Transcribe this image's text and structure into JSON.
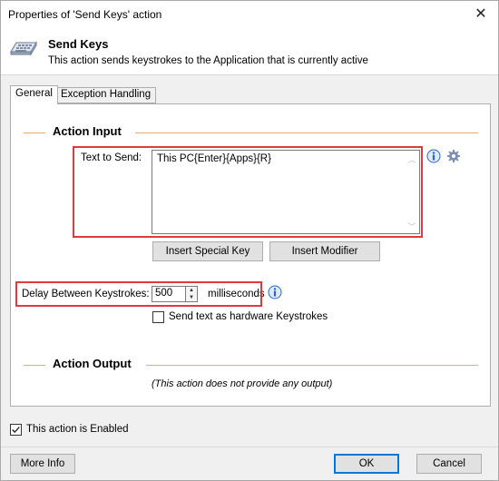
{
  "window": {
    "title": "Properties of 'Send Keys' action",
    "close_glyph": "✕"
  },
  "header": {
    "title": "Send Keys",
    "description": "This action sends keystrokes to the Application that is currently active",
    "icon": "keyboard-icon"
  },
  "tabs": [
    {
      "label": "General",
      "selected": true
    },
    {
      "label": "Exception Handling",
      "selected": false
    }
  ],
  "action_input": {
    "heading": "Action Input",
    "text_to_send_label": "Text to Send:",
    "text_to_send_value": "This PC{Enter}{Apps}{R}",
    "insert_special_key": "Insert Special Key",
    "insert_modifier": "Insert Modifier",
    "delay_label": "Delay Between Keystrokes:",
    "delay_value": "500",
    "delay_unit": "milliseconds",
    "hardware_checkbox_label": "Send text as hardware Keystrokes",
    "hardware_checked": false
  },
  "action_output": {
    "heading": "Action Output",
    "note": "(This action does not provide any output)"
  },
  "footer": {
    "enabled_label": "This action is Enabled",
    "enabled_checked": true,
    "more_info": "More Info",
    "ok": "OK",
    "cancel": "Cancel"
  },
  "colors": {
    "highlight": "#e03a3a",
    "section_line": "#e0b070",
    "focus_border": "#0078d7"
  }
}
